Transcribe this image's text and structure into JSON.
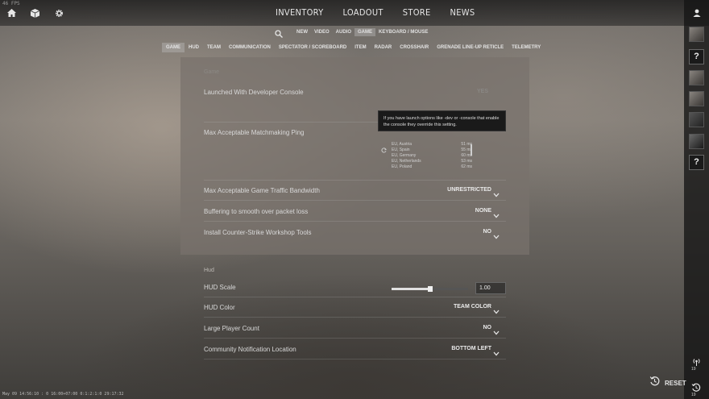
{
  "fps": "46 FPS",
  "topbar": {
    "nav": [
      "INVENTORY",
      "LOADOUT",
      "STORE",
      "NEWS"
    ]
  },
  "subnav": {
    "items": [
      "NEW",
      "VIDEO",
      "AUDIO",
      "GAME",
      "KEYBOARD / MOUSE"
    ],
    "active": "GAME"
  },
  "tabs": {
    "items": [
      "GAME",
      "HUD",
      "TEAM",
      "COMMUNICATION",
      "SPECTATOR / SCOREBOARD",
      "ITEM",
      "RADAR",
      "CROSSHAIR",
      "GRENADE LINE-UP RETICLE",
      "TELEMETRY"
    ],
    "active": "GAME"
  },
  "game_section": {
    "title": "Game",
    "rows": [
      {
        "label": "Launched With Developer Console",
        "value": "YES"
      },
      {
        "label": "Max Acceptable Matchmaking Ping",
        "value": ""
      },
      {
        "label": "Max Acceptable Game Traffic Bandwidth",
        "value": "UNRESTRICTED"
      },
      {
        "label": "Buffering to smooth over packet loss",
        "value": "NONE"
      },
      {
        "label": "Install Counter-Strike Workshop Tools",
        "value": "NO"
      }
    ],
    "tooltip": "If you have launch options like -dev or -console that enable the console they override this setting.",
    "ping_list": [
      {
        "region": "EU, Austria",
        "ping": "51 ms"
      },
      {
        "region": "EU, Spain",
        "ping": "55 ms"
      },
      {
        "region": "EU, Germany",
        "ping": "60 ms"
      },
      {
        "region": "EU, Netherlands",
        "ping": "53 ms"
      },
      {
        "region": "EU, Poland",
        "ping": "62 ms"
      }
    ]
  },
  "hud_section": {
    "title": "Hud",
    "rows": [
      {
        "label": "HUD Scale",
        "value": "1.00"
      },
      {
        "label": "HUD Color",
        "value": "TEAM COLOR"
      },
      {
        "label": "Large Player Count",
        "value": "NO"
      },
      {
        "label": "Community Notification Location",
        "value": "BOTTOM LEFT"
      }
    ],
    "hud_scale_fraction": 0.5
  },
  "statusbar": "May 09 14:56:10 : 0 16:00+07:00 0:1:2:1:0 29:17:32",
  "reset_label": "RESET",
  "rail": {
    "counts": [
      "19",
      "19"
    ]
  }
}
